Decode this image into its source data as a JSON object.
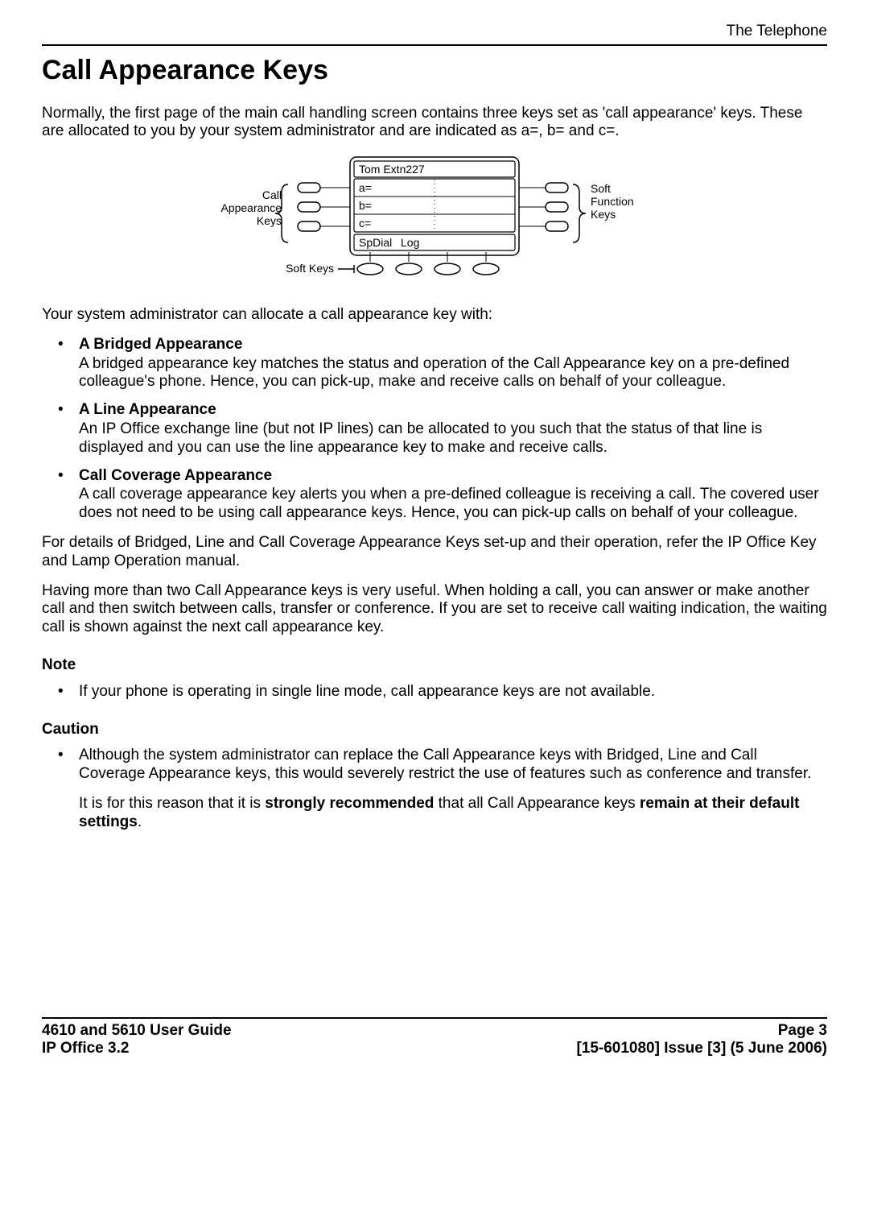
{
  "header": {
    "section": "The Telephone"
  },
  "title": "Call Appearance Keys",
  "intro": "Normally, the first page of the main call handling screen contains three keys set as 'call appearance' keys. These are allocated to you by your system administrator and are indicated as a=, b= and c=.",
  "figure": {
    "left_label_top": "Call",
    "left_label_mid": "Appearance",
    "left_label_bot": "Keys",
    "right_label_top": "Soft",
    "right_label_mid": "Function",
    "right_label_bot": "Keys",
    "bottom_label": "Soft Keys",
    "screen_title": "Tom Extn227",
    "row_a": "a=",
    "row_b": "b=",
    "row_c": "c=",
    "tab_left": "SpDial",
    "tab_right": "Log"
  },
  "after_figure": "Your system administrator can allocate a call appearance key with:",
  "appearance_items": [
    {
      "heading": "A Bridged Appearance",
      "desc": "A bridged appearance key matches the status and operation of the Call Appearance key on a pre-defined colleague's phone. Hence, you can pick-up, make and receive calls on behalf of your colleague."
    },
    {
      "heading": "A Line Appearance",
      "desc": "An IP Office exchange line (but not IP lines) can be allocated to you such that the status of that line is displayed and you can use the line appearance key to make and receive calls."
    },
    {
      "heading": "Call Coverage Appearance",
      "desc": "A call coverage appearance key alerts you when a pre-defined colleague is receiving a call. The covered user does not need to be using call appearance keys. Hence, you can pick-up calls on behalf of your colleague."
    }
  ],
  "details_para": "For details of Bridged, Line and Call Coverage Appearance Keys set-up and their operation, refer the IP Office Key and Lamp Operation manual.",
  "usefulness_para": "Having more than two Call Appearance keys is very useful. When holding a call, you can answer or make another call and then switch between calls, transfer or conference. If you are set to receive call waiting indication, the waiting call is shown against the next call appearance key.",
  "note": {
    "label": "Note",
    "item": "If your phone is operating in single line mode, call appearance keys are not available."
  },
  "caution": {
    "label": "Caution",
    "para1": "Although the system administrator can replace the Call Appearance keys with Bridged, Line and Call Coverage Appearance keys, this would severely restrict the use of features such as conference and transfer.",
    "para2_pre": "It is for this reason that it is ",
    "para2_bold1": "strongly recommended",
    "para2_mid": " that all Call Appearance keys ",
    "para2_bold2": "remain at their default settings",
    "para2_post": "."
  },
  "footer": {
    "left1": "4610 and 5610 User Guide",
    "left2": "IP Office 3.2",
    "right1": "Page 3",
    "right2": "[15-601080] Issue [3] (5 June 2006)"
  }
}
